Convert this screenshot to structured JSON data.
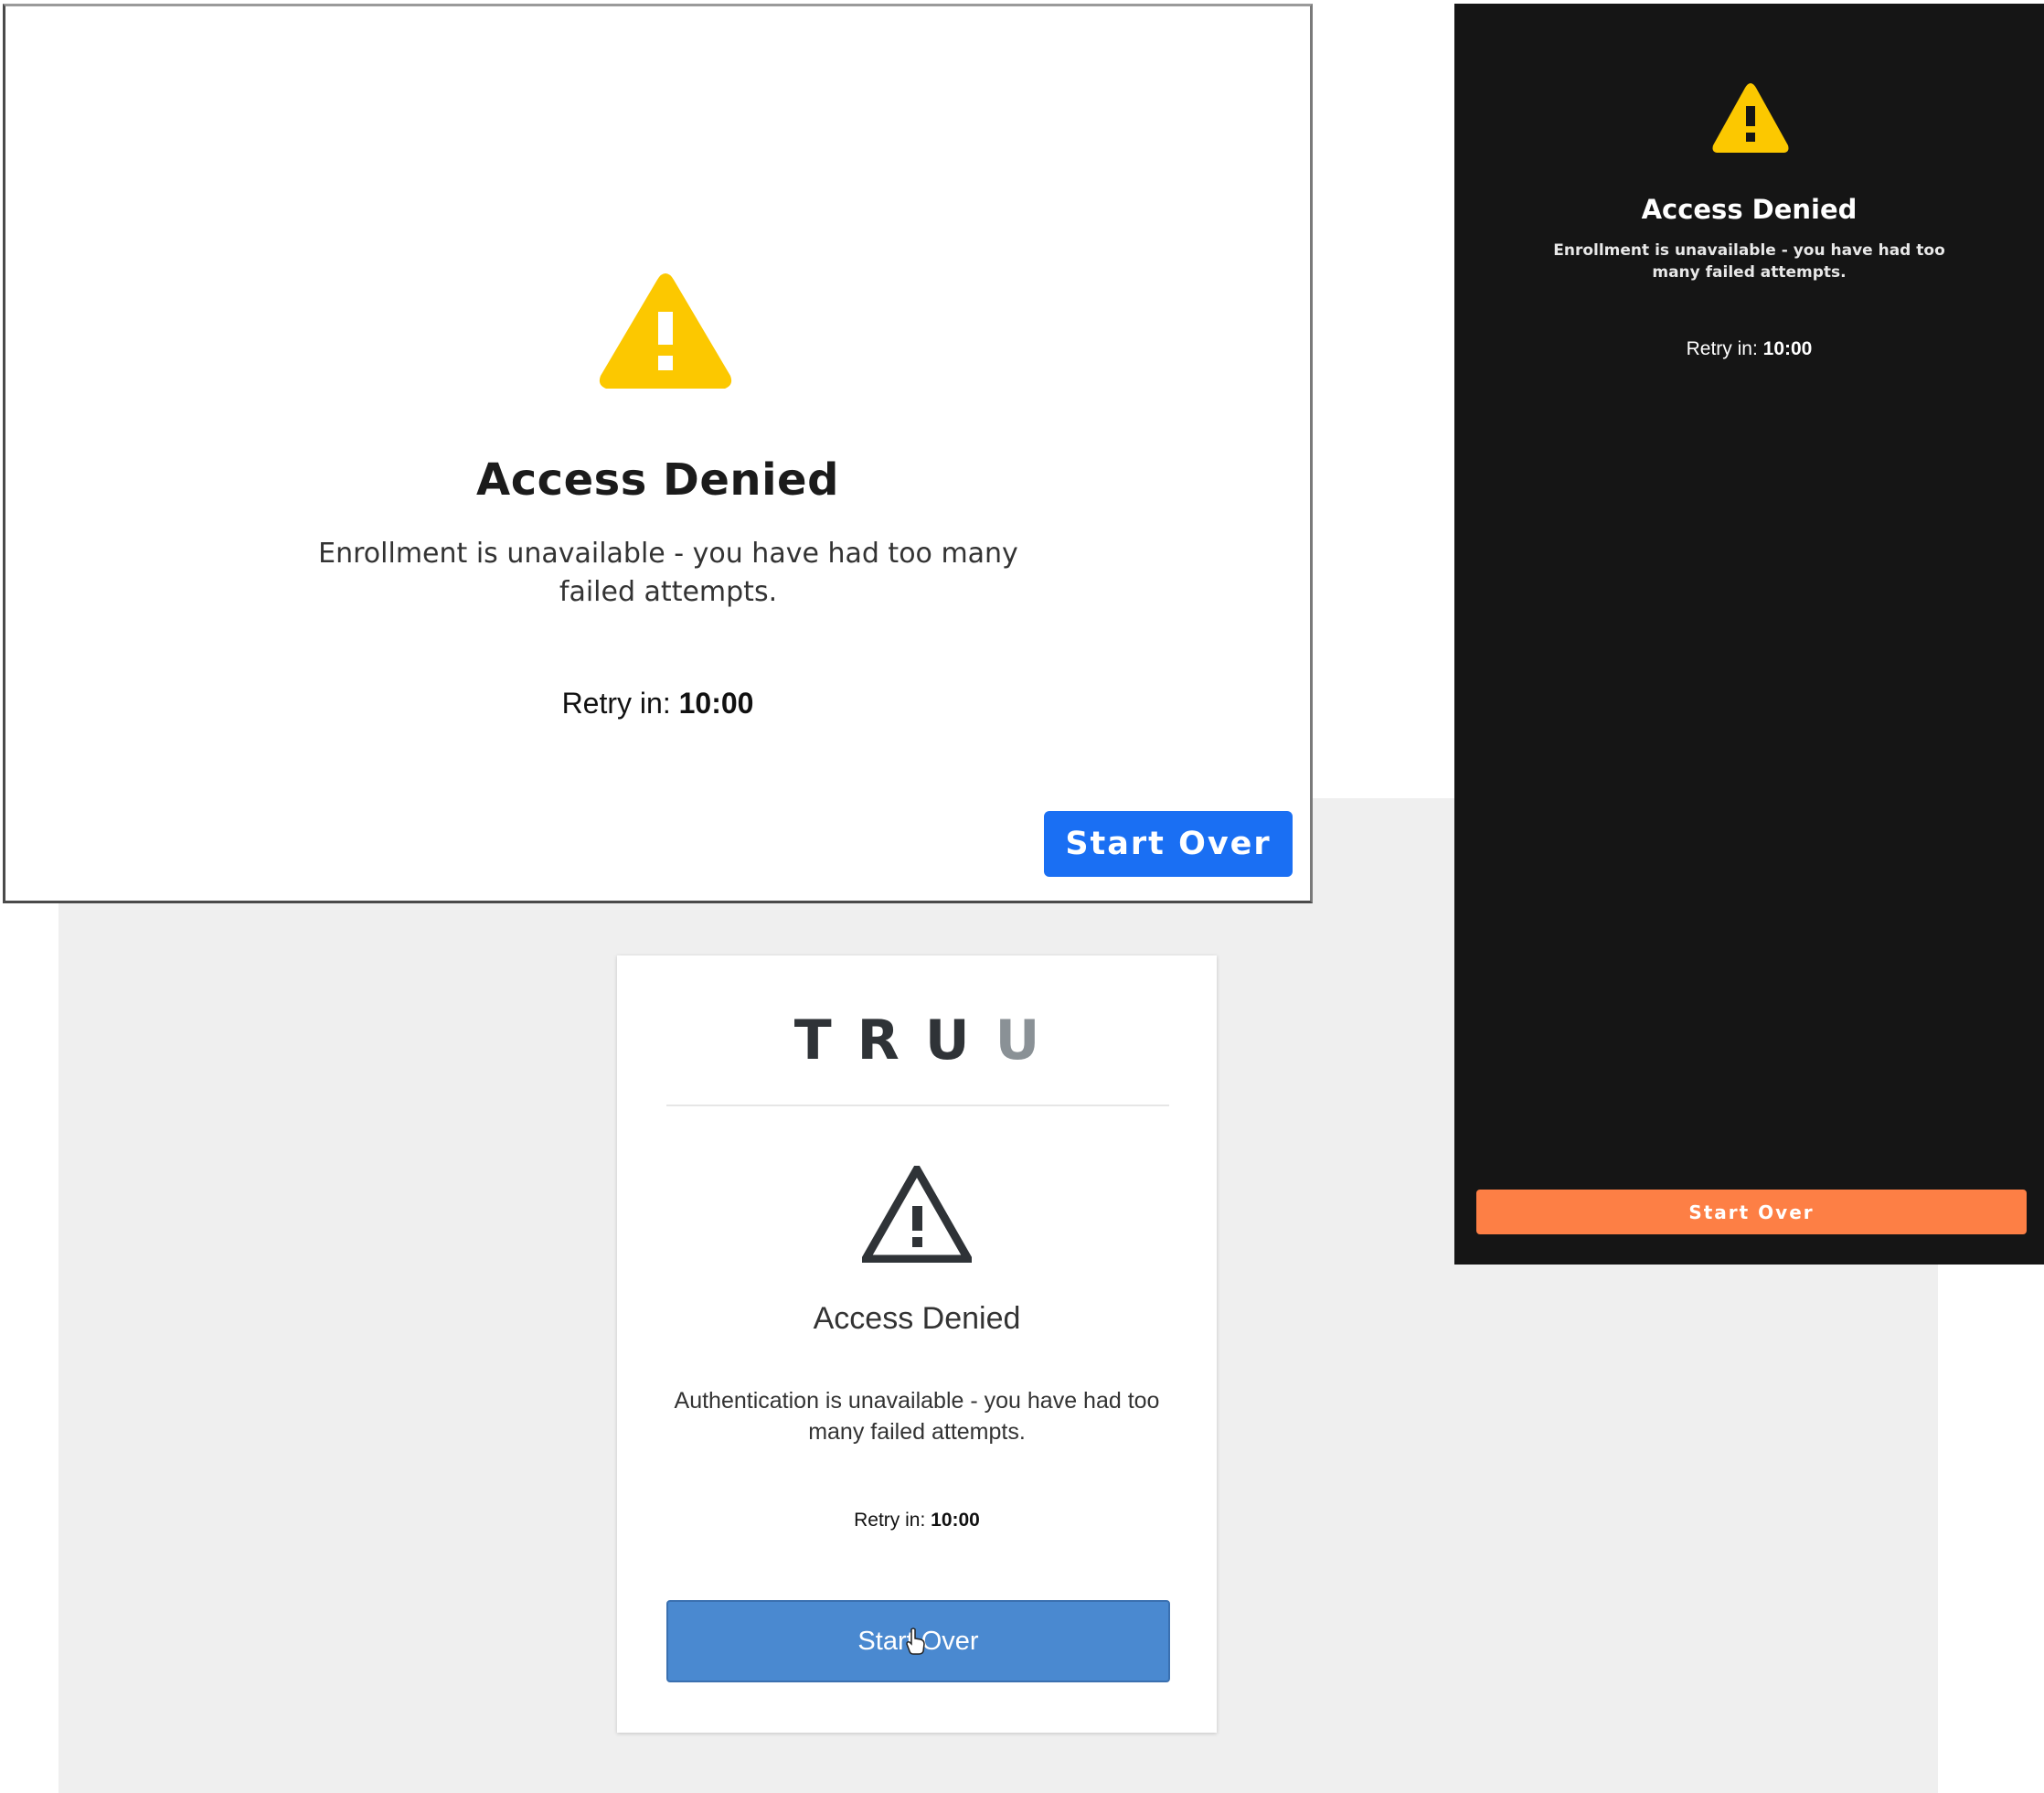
{
  "colors": {
    "warning_yellow": "#fcc800",
    "white_button": "#1a6ff3",
    "dark_button": "#fd7f45",
    "card_button": "#4a89d0",
    "dark_bg": "#151515",
    "gray_bg": "#efefef"
  },
  "white_screen": {
    "icon": "warning-triangle-icon",
    "title": "Access Denied",
    "message": "Enrollment is unavailable - you have had too many failed attempts.",
    "retry_label": "Retry in: ",
    "retry_time": "10:00",
    "button_label": "Start Over"
  },
  "dark_screen": {
    "icon": "warning-triangle-icon",
    "title": "Access Denied",
    "message": "Enrollment is unavailable - you have had too many failed attempts.",
    "retry_label": "Retry in: ",
    "retry_time": "10:00",
    "button_label": "Start Over"
  },
  "truu_card": {
    "logo_letters": [
      "T",
      "R",
      "U",
      "U"
    ],
    "icon": "warning-outline-icon",
    "title": "Access Denied",
    "message": "Authentication is unavailable - you have had too many failed attempts.",
    "retry_label": "Retry in: ",
    "retry_time": "10:00",
    "button_label": "Start Over"
  }
}
